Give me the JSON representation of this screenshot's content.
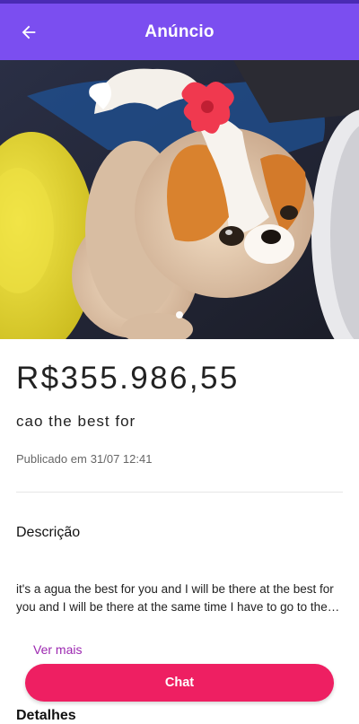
{
  "colors": {
    "app_bar": "#7b4ef0",
    "status_strip": "#4a2bb4",
    "chat_button": "#ee1f62",
    "link": "#9c27b0"
  },
  "header": {
    "title": "Anúncio",
    "back_icon": "arrow-left-icon"
  },
  "gallery": {
    "current_index": 1,
    "image_description": "Photo of a small toy puppy figure with a red bow, beside a yellow plush and a white bowl"
  },
  "listing": {
    "price": "R$355.986,55",
    "title": "cao the best for",
    "published_label": "Publicado em",
    "published_date": "31/07 12:41"
  },
  "description": {
    "heading": "Descrição",
    "text": "it's a agua the best for you and I will be there at the best for you and I will be there at the same time I have to go to the store",
    "see_more": "Ver mais"
  },
  "details": {
    "heading": "Detalhes"
  },
  "actions": {
    "chat": "Chat"
  }
}
